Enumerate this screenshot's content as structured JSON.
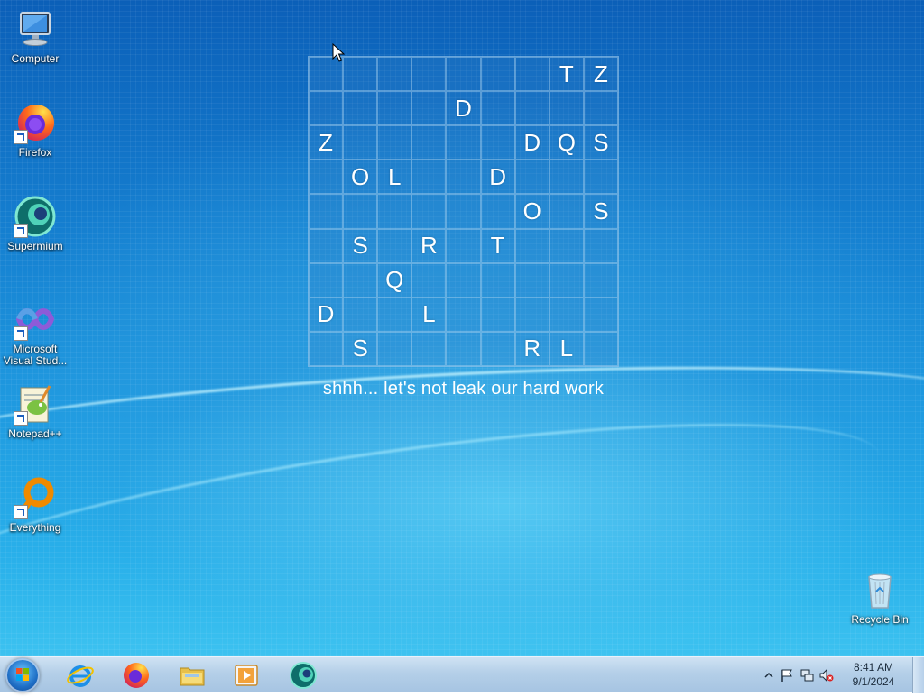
{
  "desktop": {
    "icons": [
      {
        "label_line1": "Computer",
        "label_line2": "",
        "icon": "computer-icon"
      },
      {
        "label_line1": "Firefox",
        "label_line2": "",
        "icon": "firefox-icon"
      },
      {
        "label_line1": "Supermium",
        "label_line2": "",
        "icon": "supermium-icon"
      },
      {
        "label_line1": "Microsoft",
        "label_line2": "Visual Stud...",
        "icon": "visual-studio-icon"
      },
      {
        "label_line1": "Notepad++",
        "label_line2": "",
        "icon": "notepadpp-icon"
      },
      {
        "label_line1": "Everything",
        "label_line2": "",
        "icon": "everything-icon"
      }
    ],
    "recycle_bin": {
      "label": "Recycle Bin",
      "icon": "recycle-bin-icon"
    }
  },
  "puzzle": {
    "rows": [
      [
        "",
        "",
        "",
        "",
        "",
        "",
        "",
        "T",
        "Z"
      ],
      [
        "",
        "",
        "",
        "",
        "D",
        "",
        "",
        "",
        ""
      ],
      [
        "Z",
        "",
        "",
        "",
        "",
        "",
        "D",
        "Q",
        "S"
      ],
      [
        "",
        "O",
        "L",
        "",
        "",
        "D",
        "",
        "",
        ""
      ],
      [
        "",
        "",
        "",
        "",
        "",
        "",
        "O",
        "",
        "S"
      ],
      [
        "",
        "S",
        "",
        "R",
        "",
        "T",
        "",
        "",
        ""
      ],
      [
        "",
        "",
        "Q",
        "",
        "",
        "",
        "",
        "",
        ""
      ],
      [
        "D",
        "",
        "",
        "L",
        "",
        "",
        "",
        "",
        ""
      ],
      [
        "",
        "S",
        "",
        "",
        "",
        "",
        "R",
        "L",
        ""
      ]
    ],
    "caption": "shhh... let's not leak our hard work"
  },
  "taskbar": {
    "pinned": [
      "internet-explorer-icon",
      "firefox-icon",
      "file-explorer-icon",
      "media-player-icon",
      "supermium-icon"
    ],
    "tray_icons": [
      "show-hidden-icons-chevron",
      "action-center-flag-icon",
      "network-icon",
      "volume-muted-icon"
    ],
    "clock_time": "8:41 AM",
    "clock_date": "9/1/2024"
  },
  "colors": {
    "desktop_top": "#0b5fb8",
    "desktop_bottom": "#3cc2f0",
    "taskbar": "#b4cfe8"
  }
}
